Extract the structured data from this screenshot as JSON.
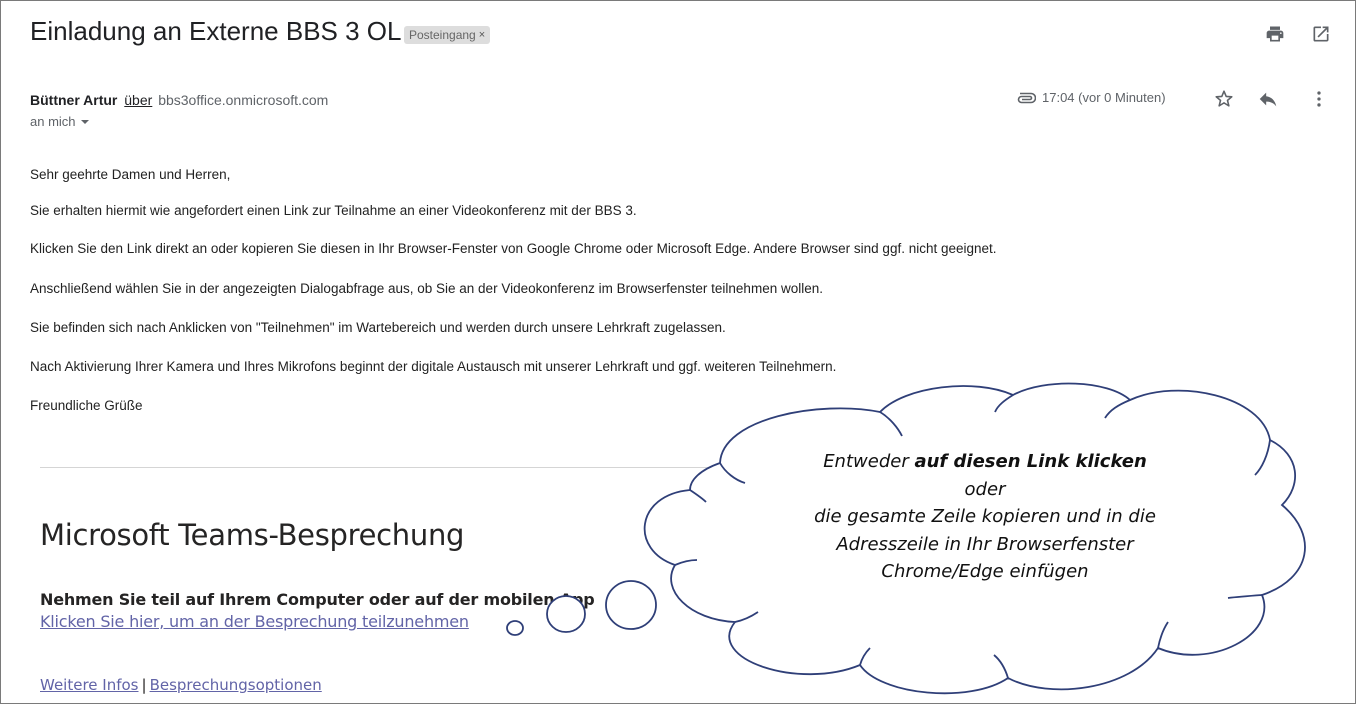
{
  "email": {
    "subject": "Einladung an Externe BBS 3 OL",
    "label": "Posteingang",
    "label_close": "×",
    "sender_name": "Büttner Artur",
    "via": "über",
    "sender_domain": "bbs3office.onmicrosoft.com",
    "recipient": "an mich",
    "time": "17:04 (vor 0 Minuten)",
    "body_lines": [
      "Sehr geehrte Damen und Herren,",
      "Sie erhalten hiermit wie angefordert einen Link zur Teilnahme an einer Videokonferenz mit der BBS 3.",
      "Klicken Sie den Link direkt an oder kopieren Sie diesen in Ihr Browser-Fenster von Google Chrome oder Microsoft Edge. Andere Browser sind ggf. nicht geeignet.",
      "Anschließend wählen Sie in der angezeigten Dialogabfrage aus, ob Sie an der Videokonferenz im Browserfenster teilnehmen wollen.",
      "Sie befinden sich nach Anklicken von \"Teilnehmen\" im Wartebereich und werden durch unsere Lehrkraft zugelassen.",
      "Nach Aktivierung Ihrer Kamera und Ihres Mikrofons beginnt der digitale Austausch mit unserer Lehrkraft und ggf. weiteren Teilnehmern.",
      "Freundliche Grüße"
    ]
  },
  "teams": {
    "title": "Microsoft Teams-Besprechung",
    "join_heading": "Nehmen Sie teil auf Ihrem Computer oder auf der mobilen App",
    "join_link": "Klicken Sie hier, um an der Besprechung teilzunehmen",
    "more_info": "Weitere Infos",
    "separator": "|",
    "options": "Besprechungsoptionen"
  },
  "callout": {
    "line1_plain": "Entweder ",
    "line1_bold": "auf diesen Link klicken",
    "line2": "oder",
    "line3": "die gesamte Zeile kopieren und in die",
    "line4": "Adresszeile in Ihr Browserfenster",
    "line5": "Chrome/Edge einfügen"
  },
  "icons": [
    "print-icon",
    "open-new-window-icon",
    "attachment-icon",
    "star-icon",
    "reply-icon",
    "more-vert-icon",
    "dropdown-arrow-icon"
  ],
  "colors": {
    "teams_link": "#6264a7",
    "cloud_outline": "#2f3f78",
    "label_bg": "#dddddd"
  }
}
